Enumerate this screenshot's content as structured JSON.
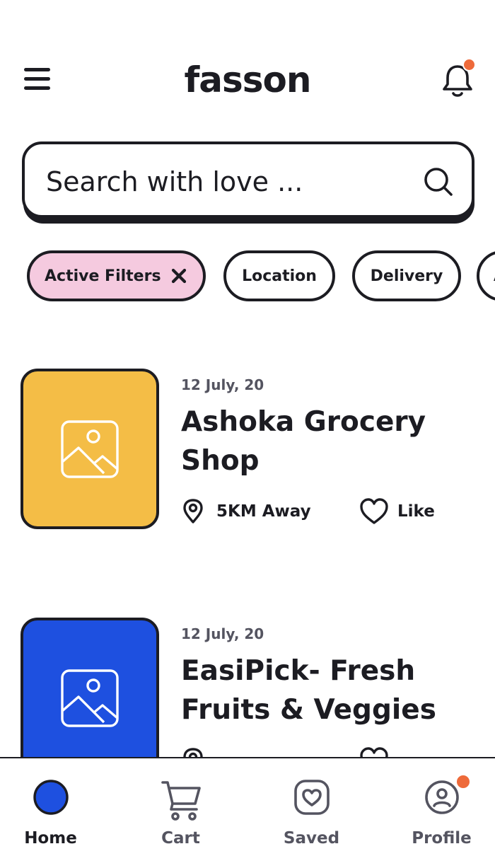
{
  "header": {
    "logo": "fasson",
    "menu_icon": "hamburger-menu-icon",
    "notification_icon": "bell-icon",
    "notification_dot_color": "#ee6a3a"
  },
  "search": {
    "placeholder": "Search with love ...",
    "icon": "search-icon"
  },
  "filters": [
    {
      "label": "Active Filters",
      "active": true,
      "icon": "close-icon"
    },
    {
      "label": "Location",
      "active": false
    },
    {
      "label": "Delivery",
      "active": false
    },
    {
      "label": "A",
      "active": false
    }
  ],
  "listings": [
    {
      "date": "12 July, 20",
      "title": "Ashoka Grocery Shop",
      "distance": "5KM Away",
      "like_label": "Like",
      "thumb_color": "#f4bd46",
      "thumb_icon": "image-icon"
    },
    {
      "date": "12 July, 20",
      "title": "EasiPick- Fresh Fruits & Veggies",
      "distance": "",
      "like_label": "",
      "thumb_color": "#1e50e0",
      "thumb_icon": "image-icon"
    }
  ],
  "bottom_nav": [
    {
      "label": "Home",
      "icon": "home-dot-icon",
      "active": true,
      "color": "#1e50e0"
    },
    {
      "label": "Cart",
      "icon": "cart-icon",
      "active": false
    },
    {
      "label": "Saved",
      "icon": "saved-heart-icon",
      "active": false
    },
    {
      "label": "Profile",
      "icon": "profile-icon",
      "active": false,
      "badge": true
    }
  ],
  "colors": {
    "text_dark": "#1c1c22",
    "text_muted": "#545460",
    "chip_active_bg": "#f5cadf",
    "accent_blue": "#1e50e0",
    "accent_yellow": "#f4bd46",
    "badge_orange": "#ee6a3a"
  }
}
